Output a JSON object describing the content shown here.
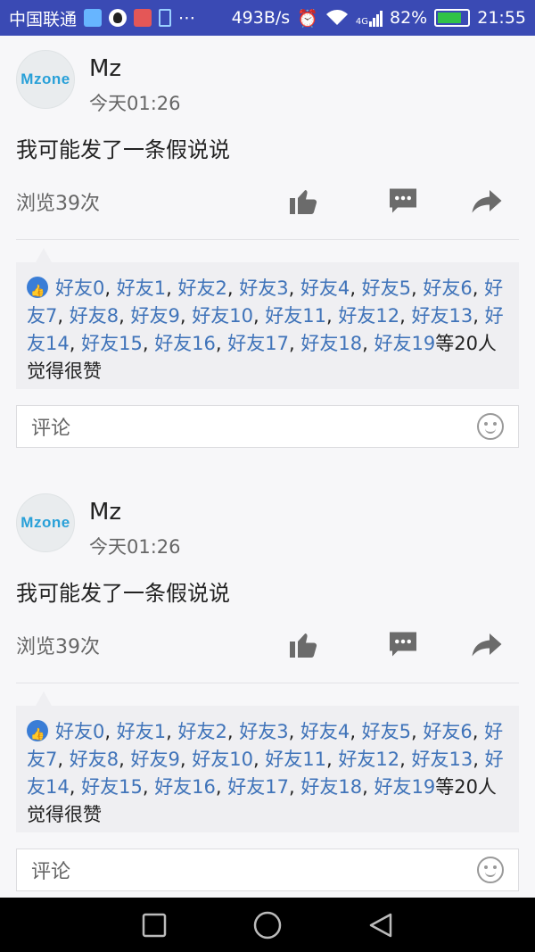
{
  "status": {
    "carrier": "中国联通",
    "net_speed": "493B/s",
    "net_type": "4G",
    "battery": "82%",
    "battery_level": 0.82,
    "time": "21:55",
    "icons": [
      "message-icon",
      "qq-icon",
      "video-icon",
      "usb-icon",
      "more-icon",
      "alarm-icon",
      "wifi-icon",
      "signal-icon",
      "battery-icon"
    ]
  },
  "posts": [
    {
      "avatar_text": "Mzone",
      "author": "Mz",
      "time": "今天01:26",
      "text": "我可能发了一条假说说",
      "views": "浏览39次",
      "likes_names": [
        "好友0",
        "好友1",
        "好友2",
        "好友3",
        "好友4",
        "好友5",
        "好友6",
        "好友7",
        "好友8",
        "好友9",
        "好友10",
        "好友11",
        "好友12",
        "好友13",
        "好友14",
        "好友15",
        "好友16",
        "好友17",
        "好友18",
        "好友19"
      ],
      "likes_suffix": "等20人觉得很赞",
      "comment_placeholder": "评论"
    },
    {
      "avatar_text": "Mzone",
      "author": "Mz",
      "time": "今天01:26",
      "text": "我可能发了一条假说说",
      "views": "浏览39次",
      "likes_names": [
        "好友0",
        "好友1",
        "好友2",
        "好友3",
        "好友4",
        "好友5",
        "好友6",
        "好友7",
        "好友8",
        "好友9",
        "好友10",
        "好友11",
        "好友12",
        "好友13",
        "好友14",
        "好友15",
        "好友16",
        "好友17",
        "好友18",
        "好友19"
      ],
      "likes_suffix": "等20人觉得很赞",
      "comment_placeholder": "评论"
    }
  ],
  "colors": {
    "status_bar": "#3a4ab4",
    "link": "#3f73b9",
    "like_icon": "#3a7dd6",
    "battery_fill": "#31c248"
  }
}
